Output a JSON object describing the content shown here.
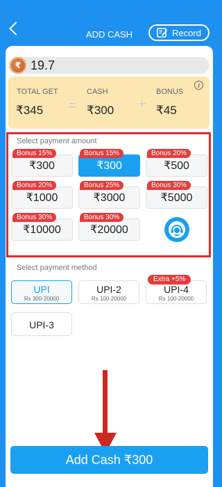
{
  "header": {
    "title": "ADD CASH",
    "record_label": "Record"
  },
  "balance": {
    "currency_symbol": "₹",
    "value": "19.7"
  },
  "summary": {
    "total_get_label": "TOTAL GET",
    "total_get_value": "₹345",
    "cash_label": "CASH",
    "cash_value": "₹300",
    "bonus_label": "BONUS",
    "bonus_value": "₹45",
    "op_equals": "=",
    "op_plus": "+"
  },
  "payment_amount": {
    "label": "Select payment amount",
    "options": [
      {
        "bonus": "Bonus 15%",
        "amount": "₹300",
        "selected": false
      },
      {
        "bonus": "Bonus 15%",
        "amount": "₹300",
        "selected": true
      },
      {
        "bonus": "Bonus 20%",
        "amount": "₹500",
        "selected": false
      },
      {
        "bonus": "Bonus 20%",
        "amount": "₹1000",
        "selected": false
      },
      {
        "bonus": "Bonus 25%",
        "amount": "₹3000",
        "selected": false
      },
      {
        "bonus": "Bonus 30%",
        "amount": "₹5000",
        "selected": false
      },
      {
        "bonus": "Bonus 30%",
        "amount": "₹10000",
        "selected": false
      },
      {
        "bonus": "Bonus 30%",
        "amount": "₹20000",
        "selected": false
      }
    ]
  },
  "payment_method": {
    "label": "Select payment method",
    "methods": [
      {
        "name": "UPI",
        "range": "Rs 300-20000",
        "selected": true
      },
      {
        "name": "UPI-2",
        "range": "Rs 100-20000",
        "selected": false
      },
      {
        "name": "UPI-4",
        "range": "Rs 100-20000",
        "selected": false,
        "tag": "Extra +5%"
      },
      {
        "name": "UPI-3",
        "range": "",
        "selected": false
      }
    ]
  },
  "cta": {
    "label": "Add Cash ₹300"
  },
  "colors": {
    "primary_blue": "#1e90ef",
    "selected_blue": "#1aa0f0",
    "bonus_red": "#e33d3d",
    "highlight_red": "#e22b2b",
    "summary_bg": "#fce7b3"
  }
}
